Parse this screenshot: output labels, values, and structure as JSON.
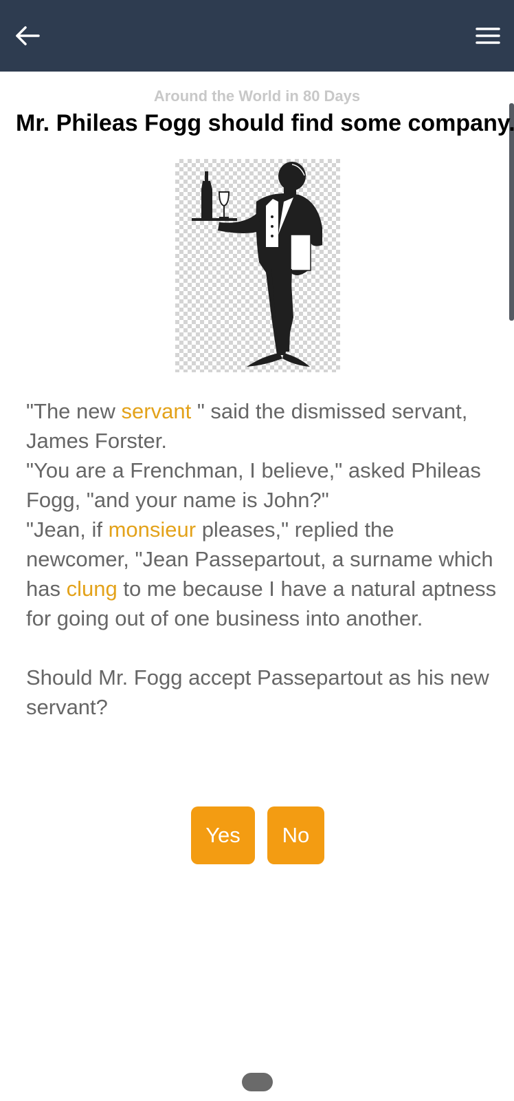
{
  "header": {
    "back_icon": "arrow-left-icon",
    "menu_icon": "hamburger-menu-icon",
    "background_color": "#2e3c50"
  },
  "content": {
    "book_title": "Around the World in 80 Days",
    "headline": "Mr. Phileas Fogg should find some company.",
    "illustration": "butler-silhouette-image",
    "paragraph": [
      {
        "t1": "\"The new ",
        "w1": "servant",
        "t2": " \" said the dismissed servant, James Forster."
      },
      {
        "t1": "\"You are a Frenchman, I believe,\" asked Phileas Fogg, \"and your name is John?\""
      },
      {
        "t1": "\"Jean, if ",
        "w1": "monsieur",
        "t2": " pleases,\" replied the newcomer, \"Jean Passepartout, a surname which has ",
        "w2": "clung",
        "t3": " to me because I have a natural aptness for going out of one business into another."
      }
    ],
    "question": "Should Mr. Fogg accept Passepartout as his new servant?",
    "highlight_color": "#e3a21a"
  },
  "actions": {
    "yes_label": "Yes",
    "no_label": "No",
    "button_color": "#f39c12"
  }
}
